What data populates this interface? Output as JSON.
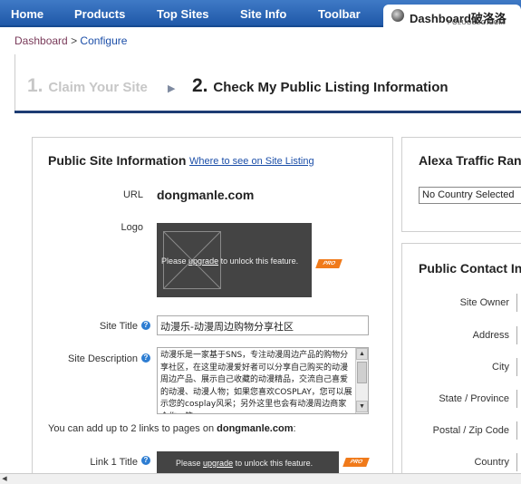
{
  "nav": {
    "items": [
      "Home",
      "Products",
      "Top Sites",
      "Site Info",
      "Toolbar"
    ],
    "active": "Dashboard",
    "overlay_text": "破洛洛",
    "watermark": "POLUOLUO.COM"
  },
  "breadcrumb": {
    "root": "Dashboard",
    "sep": ">",
    "current": "Configure"
  },
  "steps": {
    "step1_num": "1.",
    "step1_label": "Claim Your Site",
    "arrow": "▶",
    "step2_num": "2.",
    "step2_label": "Check My Public Listing Information"
  },
  "site_info": {
    "title": "Public Site Information",
    "link": "Where to see on Site Listing",
    "url_label": "URL",
    "url_value": "dongmanle.com",
    "logo_label": "Logo",
    "unlock_pre": "Please",
    "unlock_link": "upgrade",
    "unlock_post": "to unlock this feature.",
    "pro_badge": "PRO",
    "site_title_label": "Site Title",
    "site_title_value": "动漫乐-动漫周边购物分享社区",
    "site_desc_label": "Site Description",
    "site_desc_value": "动漫乐是一家基于SNS，专注动漫周边产品的购物分享社区，在这里动漫爱好者可以分享自己购买的动漫周边产品、展示自己收藏的动漫精品，交流自己喜爱的动漫、动漫人物；如果您喜欢COSPLAY，您可以展示您的cosplay风采；另外这里也会有动漫周边商家合作，第",
    "links_note_pre": "You can add up to 2 links to pages on",
    "links_note_site": "dongmanle.com",
    "links_note_post": ":",
    "link1_label": "Link 1 Title"
  },
  "traffic": {
    "title": "Alexa Traffic Rank",
    "country_selected": "No Country Selected"
  },
  "contact": {
    "title": "Public Contact Info",
    "fields": [
      "Site Owner",
      "Address",
      "City",
      "State / Province",
      "Postal / Zip Code",
      "Country"
    ]
  },
  "icons": {
    "help": "question-icon",
    "dashboard": "dashboard-gauge-icon"
  },
  "colors": {
    "nav_bg": "#2a63b2",
    "link": "#1b4ea8",
    "pro_badge": "#f07a1a",
    "steps_line": "#1d3c73"
  }
}
